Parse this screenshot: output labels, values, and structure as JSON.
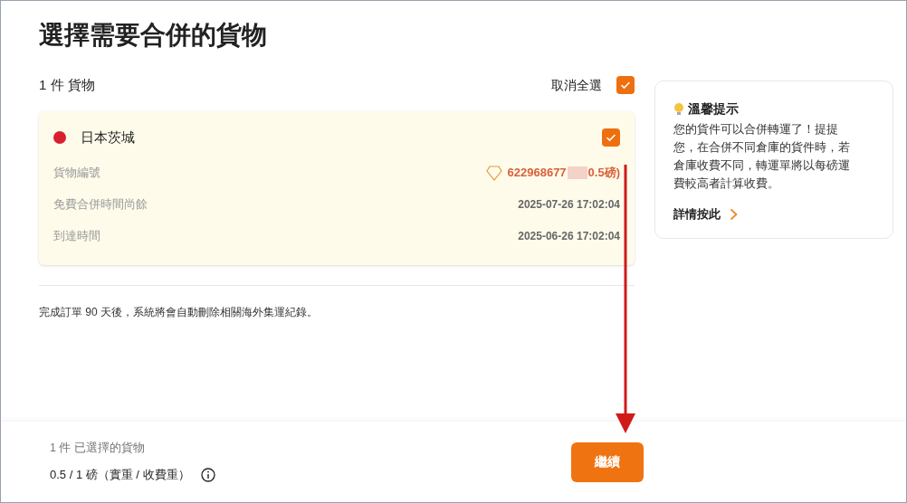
{
  "title": "選擇需要合併的貨物",
  "list_header": {
    "count": "1 件 貨物",
    "deselect_all": "取消全選",
    "checked": true
  },
  "package": {
    "origin": "日本茨城",
    "color": "#d8202e",
    "checked": true,
    "rows": [
      {
        "kind": "tracking",
        "label": "貨物編號",
        "value": "622968677",
        "value_tail": "0.5磅)"
      },
      {
        "kind": "plain",
        "label": "免費合併時間尚餘",
        "value": "2025-07-26 17:02:04"
      },
      {
        "kind": "plain",
        "label": "到達時間",
        "value": "2025-06-26 17:02:04"
      }
    ]
  },
  "notice": "完成訂單 90 天後，系統將會自動刪除相關海外集運紀錄。",
  "tip": {
    "title": "溫馨提示",
    "body": "您的貨件可以合併轉運了！提提您，在合併不同倉庫的貨件時，若倉庫收費不同，轉運單將以每磅運費較高者計算收費。",
    "link": "詳情按此"
  },
  "footer": {
    "selected": "1 件 已選擇的貨物",
    "weight": "0.5 / 1 磅（實重 / 收費重）",
    "button": "繼續"
  }
}
